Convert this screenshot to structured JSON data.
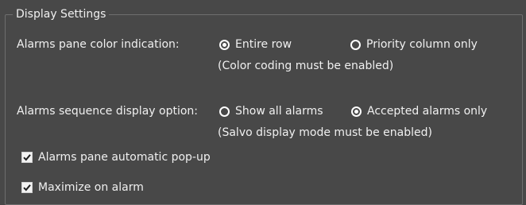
{
  "group": {
    "title": "Display Settings"
  },
  "color_indication": {
    "label": "Alarms pane color indication:",
    "options": [
      {
        "label": "Entire row",
        "selected": true
      },
      {
        "label": "Priority column only",
        "selected": false
      }
    ],
    "note": "(Color coding must be enabled)"
  },
  "sequence_display": {
    "label": "Alarms sequence display option:",
    "options": [
      {
        "label": "Show all alarms",
        "selected": false
      },
      {
        "label": "Accepted alarms only",
        "selected": true
      }
    ],
    "note": "(Salvo display mode must be enabled)"
  },
  "checkboxes": [
    {
      "label": "Alarms pane automatic pop-up",
      "checked": true
    },
    {
      "label": "Maximize on alarm",
      "checked": true
    }
  ]
}
